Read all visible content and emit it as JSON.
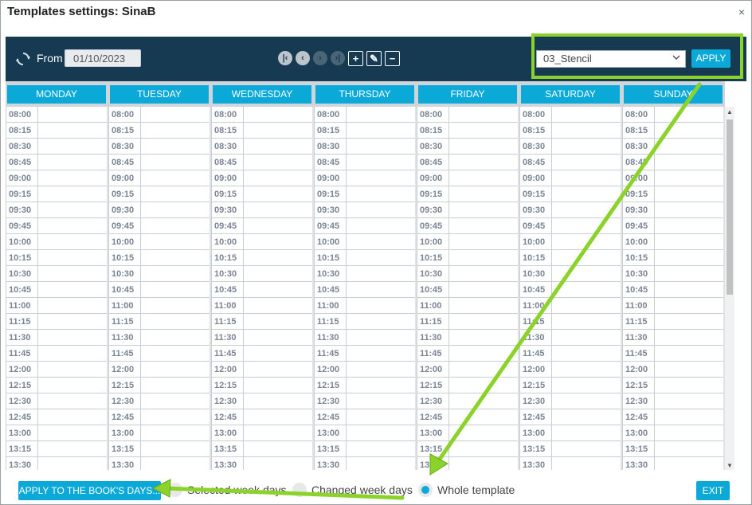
{
  "window": {
    "title": "Templates settings: SinaB",
    "close_glyph": "×"
  },
  "toolbar": {
    "from_label": "From",
    "from_value": "01/10/2023",
    "nav_buttons": [
      {
        "icon": "first-page-icon",
        "glyph": "K"
      },
      {
        "icon": "previous-icon",
        "glyph": "‹"
      },
      {
        "icon": "next-icon",
        "glyph": "›"
      },
      {
        "icon": "last-page-icon",
        "glyph": "›|"
      },
      {
        "icon": "add-icon",
        "glyph": "+"
      },
      {
        "icon": "edit-icon",
        "glyph": "✎"
      },
      {
        "icon": "minus-icon",
        "glyph": "−"
      }
    ],
    "template_select": "03_Stencil",
    "apply_label": "APPLY"
  },
  "days": [
    "MONDAY",
    "TUESDAY",
    "WEDNESDAY",
    "THURSDAY",
    "FRIDAY",
    "SATURDAY",
    "SUNDAY"
  ],
  "times": [
    "08:00",
    "08:15",
    "08:30",
    "08:45",
    "09:00",
    "09:15",
    "09:30",
    "09:45",
    "10:00",
    "10:15",
    "10:30",
    "10:45",
    "11:00",
    "11:15",
    "11:30",
    "11:45",
    "12:00",
    "12:15",
    "12:30",
    "12:45",
    "13:00",
    "13:15",
    "13:30"
  ],
  "footer": {
    "apply_book_label": "APPLY TO THE BOOK'S DAYS...",
    "radios": [
      {
        "label": "Selected week days",
        "checked": false
      },
      {
        "label": "Changed week days",
        "checked": false
      },
      {
        "label": "Whole template",
        "checked": true
      }
    ],
    "exit_label": "EXIT"
  },
  "colors": {
    "header_bg": "#153a52",
    "accent": "#0aa9d8",
    "highlight": "#8bd32b"
  }
}
